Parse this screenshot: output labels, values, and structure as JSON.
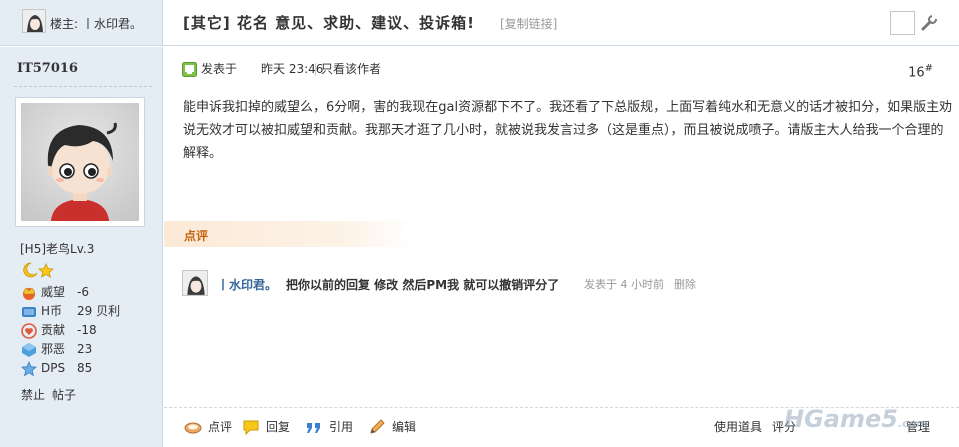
{
  "header": {
    "op_label": "楼主:",
    "op_name": "丨水印君。",
    "thread_title": "[其它] 花名 意见、求助、建议、投诉箱!",
    "copy_link": "[复制链接]"
  },
  "author": {
    "name": "IT57016",
    "rank": "[H5]老鸟Lv.3",
    "stats": [
      {
        "icon": "crown-icon",
        "label": "威望",
        "value": "-6"
      },
      {
        "icon": "coin-icon",
        "label": "H币",
        "value": "29 贝利"
      },
      {
        "icon": "heart-icon",
        "label": "贡献",
        "value": "-18"
      },
      {
        "icon": "cube-icon",
        "label": "邪恶",
        "value": "23"
      },
      {
        "icon": "star-icon",
        "label": "DPS",
        "value": "85"
      }
    ],
    "actions": [
      "禁止",
      "帖子"
    ]
  },
  "post": {
    "posted_label": "发表于",
    "posted_time": "昨天 23:46",
    "author_only": "只看该作者",
    "floor": "16",
    "floor_mark": "#",
    "content": "能申诉我扣掉的威望么，6分啊，害的我现在gal资源都下不了。我还看了下总版规，上面写着纯水和无意义的话才被扣分，如果版主劝说无效才可以被扣威望和贡献。我那天才逛了几小时，就被说我发言过多（这是重点），而且被说成喷子。请版主大人给我一个合理的解释。",
    "rate_label": "点评",
    "comment": {
      "user": "丨水印君。",
      "text": "把你以前的回复 修改 然后PM我 就可以撤销评分了",
      "time": "发表于 4 小时前",
      "delete": "删除"
    }
  },
  "footer": {
    "buttons": [
      {
        "icon": "comment-icon",
        "label": "点评"
      },
      {
        "icon": "reply-icon",
        "label": "回复"
      },
      {
        "icon": "quote-icon",
        "label": "引用"
      },
      {
        "icon": "edit-icon",
        "label": "编辑"
      }
    ],
    "right": [
      "使用道具",
      "评分",
      "管理"
    ]
  },
  "watermark": {
    "text": "HGame5",
    "suffix": ".com"
  }
}
